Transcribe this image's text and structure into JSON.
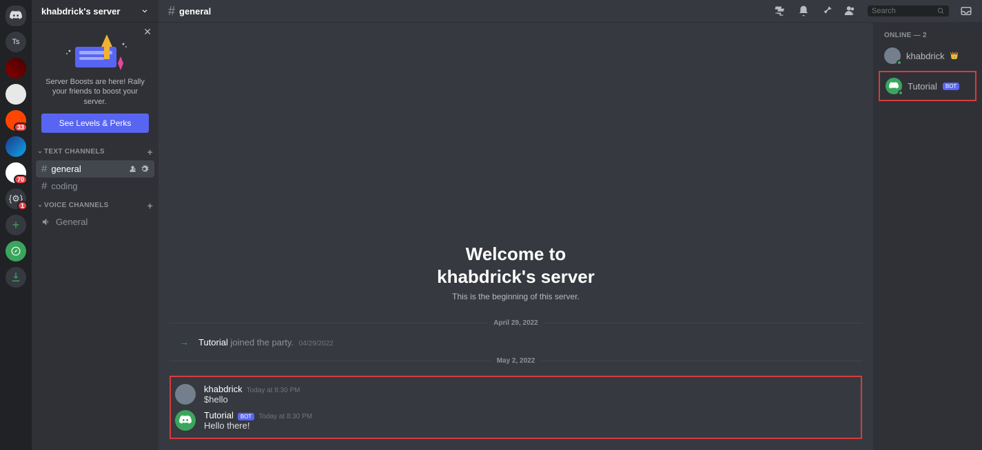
{
  "guilds": {
    "home": "D",
    "ts": "Ts",
    "badges": {
      "g4": "33",
      "g6": "70",
      "g7": "1"
    }
  },
  "sidebar": {
    "server_name": "khabdrick's server",
    "boost": {
      "text": "Server Boosts are here! Rally your friends to boost your server.",
      "button": "See Levels & Perks"
    },
    "cat_text": "TEXT CHANNELS",
    "cat_voice": "VOICE CHANNELS",
    "channels": {
      "general": "general",
      "coding": "coding",
      "voice_general": "General"
    }
  },
  "header": {
    "channel": "general",
    "search_placeholder": "Search"
  },
  "chat": {
    "welcome_line1": "Welcome to",
    "welcome_line2": "khabdrick's server",
    "welcome_sub": "This is the beginning of this server.",
    "divider1": "April 29, 2022",
    "divider2": "May 2, 2022",
    "sys_user": "Tutorial",
    "sys_text": " joined the party.",
    "sys_time": "04/29/2022",
    "msg1": {
      "author": "khabdrick",
      "time": "Today at 8:30 PM",
      "text": "$hello"
    },
    "msg2": {
      "author": "Tutorial",
      "bot": "BOT",
      "time": "Today at 8:30 PM",
      "text": "Hello there!"
    }
  },
  "members": {
    "header": "ONLINE — 2",
    "m1": "khabdrick",
    "m2": "Tutorial",
    "m2_bot": "BOT"
  }
}
